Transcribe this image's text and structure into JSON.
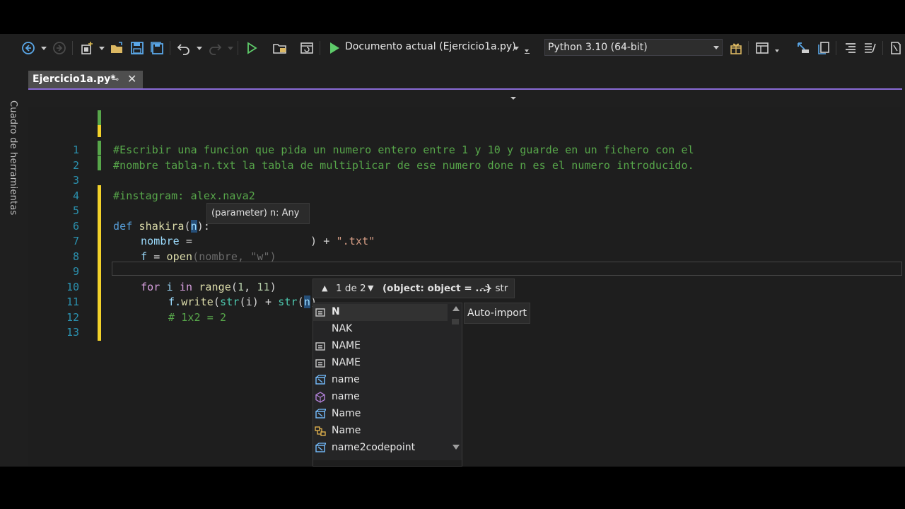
{
  "toolbar": {
    "run_target_label": "Documento actual (Ejercicio1a.py)",
    "python_env": "Python 3.10 (64-bit)"
  },
  "sidebar": {
    "toolbox_label": "Cuadro de herramientas"
  },
  "tab": {
    "title": "Ejercicio1a.py*",
    "pin_glyph": "⊸",
    "close_glyph": "✕"
  },
  "editor": {
    "line_numbers": [
      "1",
      "2",
      "3",
      "4",
      "5",
      "6",
      "7",
      "8",
      "9",
      "10",
      "11",
      "12",
      "13"
    ],
    "lines": {
      "l1": "#Escribir una funcion que pida un numero entero entre 1 y 10 y guarde en un fichero con el",
      "l2": "#nombre tabla-n.txt la tabla de multiplicar de ese numero done n es el numero introducido.",
      "l4": "#instagram: alex.nava2",
      "l6_kw": "def",
      "l6_fn": "shakira",
      "l6_open": "(",
      "l6_param": "n",
      "l6_close": "):",
      "l7_var": "nombre",
      "l7_eq": " = ",
      "l7_close": ")",
      "l7_plus": " + ",
      "l7_str": "\".txt\"",
      "l8_var": "f",
      "l8_eq": " = ",
      "l8_fn": "open",
      "l8_rest": "(nombre, \"w\")",
      "l10_for": "for",
      "l10_i": " i ",
      "l10_in": "in",
      "l10_range": "range",
      "l10_open": "(",
      "l10_n1": "1",
      "l10_comma": ", ",
      "l10_n2": "11",
      "l10_close": ")",
      "l11_f": "f.",
      "l11_write": "write",
      "l11_a": "(",
      "l11_str1": "str",
      "l11_b": "(i) + ",
      "l11_str2": "str",
      "l11_c": "(",
      "l11_n": "n",
      "l11_d": ")",
      "l12": "# 1x2 = 2"
    }
  },
  "tooltip": {
    "text": "(parameter) n: Any"
  },
  "signature_help": {
    "up_glyph": "▲",
    "count": "1 de 2",
    "down_glyph": "▼",
    "signature": "(object: object = ...)",
    "returns": "-> str"
  },
  "completion": {
    "items": [
      {
        "label": "N",
        "icon": "constant-icon"
      },
      {
        "label": "NAK",
        "icon": "constant-icon"
      },
      {
        "label": "NAME",
        "icon": "constant-icon"
      },
      {
        "label": "NAME",
        "icon": "constant-icon"
      },
      {
        "label": "name",
        "icon": "variable-icon"
      },
      {
        "label": "name",
        "icon": "module-icon"
      },
      {
        "label": "Name",
        "icon": "variable-icon"
      },
      {
        "label": "Name",
        "icon": "class-icon"
      },
      {
        "label": "name2codepoint",
        "icon": "variable-icon"
      }
    ],
    "auto_import_label": "Auto-import"
  },
  "colors": {
    "accent_tab_underline": "#8a6bd6",
    "comment": "#57a64a",
    "keyword": "#569cd6",
    "function": "#dcdcaa",
    "string": "#d69d85",
    "line_number": "#2b91af"
  }
}
